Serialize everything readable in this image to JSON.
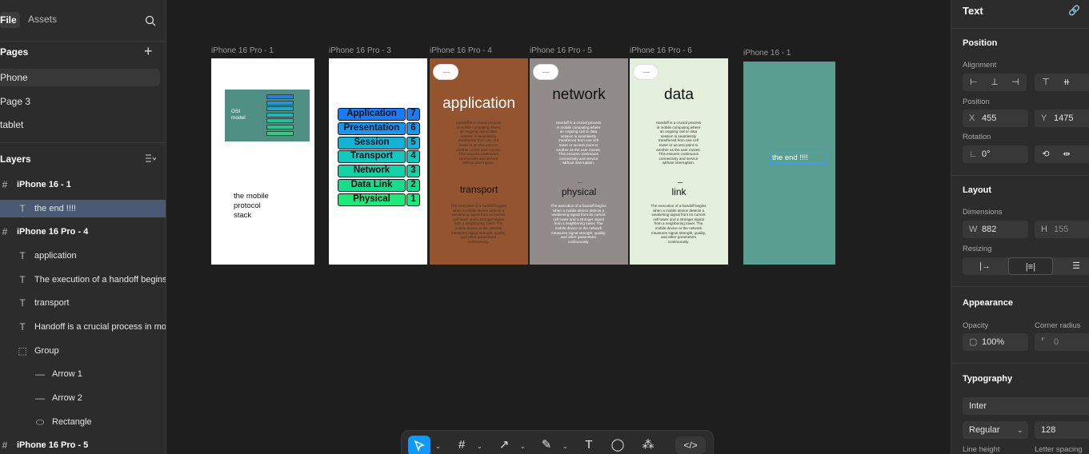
{
  "left": {
    "tabs": [
      "File",
      "Assets"
    ],
    "pages_title": "Pages",
    "pages": [
      "Phone",
      "Page 3",
      "tablet"
    ],
    "layers_title": "Layers",
    "layers": [
      {
        "label": "iPhone 16 - 1",
        "icon": "#"
      },
      {
        "label": "the end !!!!",
        "icon": "T"
      },
      {
        "label": "iPhone 16 Pro - 4",
        "icon": "#"
      },
      {
        "label": "application",
        "icon": "T"
      },
      {
        "label": "The execution of a handoff begins",
        "icon": "T"
      },
      {
        "label": "transport",
        "icon": "T"
      },
      {
        "label": "Handoff is a crucial process in mo",
        "icon": "T"
      },
      {
        "label": "Group",
        "icon": "⬚"
      },
      {
        "label": "Arrow 1",
        "icon": "—"
      },
      {
        "label": "Arrow 2",
        "icon": "—"
      },
      {
        "label": "Rectangle",
        "icon": "⬭"
      },
      {
        "label": "iPhone 16 Pro - 5",
        "icon": "#"
      }
    ]
  },
  "canvas": {
    "frames": [
      {
        "label": "iPhone 16 Pro - 1",
        "caption": [
          "the mobile",
          "protocol",
          "stack"
        ],
        "thumb_title": [
          "OSI",
          "model"
        ]
      },
      {
        "label": "iPhone 16 Pro - 3"
      },
      {
        "label": "iPhone 16 Pro - 4",
        "title": "application",
        "sub": "transport",
        "bg": "#93542f"
      },
      {
        "label": "iPhone 16 Pro - 5",
        "title": "network",
        "sub": "physical",
        "bg": "#918b8a"
      },
      {
        "label": "iPhone 16 Pro - 6",
        "title": "data",
        "sub": "link",
        "bg": "#e5efdd"
      },
      {
        "label": "iPhone 16 - 1",
        "text": "the end !!!!",
        "bg": "#5a9e92"
      }
    ],
    "para1": [
      "Handoff is a crucial process",
      "in mobile computing where",
      "an ongoing call or data",
      "session is seamlessly",
      "transferred from one cell",
      "tower or access point to",
      "another as the user moves.",
      "This ensures continuous",
      "connectivity and service",
      "without interruption."
    ],
    "para2": [
      "The execution of a handoff begins",
      "when a mobile device detects a",
      "weakening signal from its current",
      "cell tower and a stronger signal",
      "from a neighboring tower. The",
      "mobile device or the network",
      "measures signal strength, quality,",
      "and other parameters",
      "continuously."
    ],
    "osi_layers": [
      {
        "name": "Application",
        "num": "7",
        "color": "#1a7cf5"
      },
      {
        "name": "Presentation",
        "num": "6",
        "color": "#1a95f0"
      },
      {
        "name": "Session",
        "num": "5",
        "color": "#14b3d6"
      },
      {
        "name": "Transport",
        "num": "4",
        "color": "#14c7c0"
      },
      {
        "name": "Network",
        "num": "3",
        "color": "#16d0a6"
      },
      {
        "name": "Data Link",
        "num": "2",
        "color": "#18dc8c"
      },
      {
        "name": "Physical",
        "num": "1",
        "color": "#1ee87a"
      }
    ]
  },
  "right": {
    "title": "Text",
    "position_title": "Position",
    "alignment_label": "Alignment",
    "position_label": "Position",
    "x_prefix": "X",
    "x": "455",
    "y_prefix": "Y",
    "y": "1475",
    "rotation_label": "Rotation",
    "rotation": "0°",
    "layout_title": "Layout",
    "dimensions_label": "Dimensions",
    "w_prefix": "W",
    "w": "882",
    "h_prefix": "H",
    "h": "155",
    "resizing_label": "Resizing",
    "appearance_title": "Appearance",
    "opacity_label": "Opacity",
    "opacity": "100%",
    "radius_label": "Corner radius",
    "radius": "0",
    "typography_title": "Typography",
    "font": "Inter",
    "weight": "Regular",
    "size": "128",
    "line_height_label": "Line height",
    "letter_spacing_label": "Letter spacing"
  },
  "colors": {
    "accent": "#0d99ff",
    "selection": "#4a5a75"
  }
}
